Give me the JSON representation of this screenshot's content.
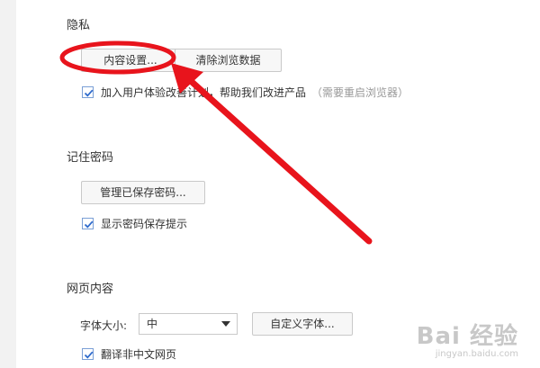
{
  "privacy": {
    "title": "隐私",
    "content_settings_label": "内容设置...",
    "clear_data_label": "清除浏览数据",
    "ux_program_label": "加入用户体验改善计划，帮助我们改进产品",
    "ux_program_hint": "（需要重启浏览器）",
    "ux_program_checked": true
  },
  "passwords": {
    "title": "记住密码",
    "manage_label": "管理已保存密码...",
    "show_hint_label": "显示密码保存提示",
    "show_hint_checked": true
  },
  "web_content": {
    "title": "网页内容",
    "font_size_label": "字体大小:",
    "font_size_value": "中",
    "custom_font_label": "自定义字体...",
    "translate_label": "翻译非中文网页",
    "translate_checked": true
  },
  "annotation": {
    "color": "#e8141c"
  },
  "watermark": {
    "text": "Bai 经验",
    "url": "jingyan.baidu.com"
  },
  "colors": {
    "checkbox_border": "#7a9fd6",
    "checkmark": "#2f6bcc"
  }
}
